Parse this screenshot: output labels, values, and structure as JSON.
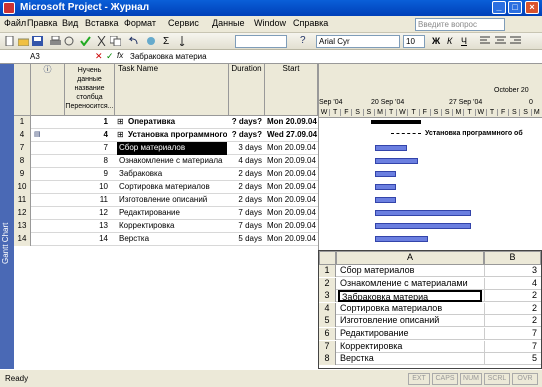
{
  "window": {
    "title": "Microsoft Project - Журнал"
  },
  "menu": [
    "Файл",
    "Правка",
    "Вид",
    "Вставка",
    "Формат",
    "Сервис",
    "Данные",
    "Window",
    "Справка"
  ],
  "help_placeholder": "Введите вопрос",
  "toolbar": {
    "font": "Arial Cyr",
    "size": "10",
    "bold": "Ж",
    "italic": "К",
    "underline": "Ч"
  },
  "formula": {
    "cell": "A3",
    "value": "Забраковка материа"
  },
  "grid": {
    "headers": {
      "ind": "ⓘ",
      "num": "Нучень данные название столбца Переносится...",
      "task": "Task Name",
      "duration": "Duration",
      "start": "Start"
    },
    "rows": [
      {
        "rn": "1",
        "num": "1",
        "name": "Оперативка",
        "dur": "? days?",
        "start": "Mon 20.09.04",
        "bold": true,
        "expand": true
      },
      {
        "rn": "4",
        "num": "4",
        "name": "Установка программного",
        "dur": "? days?",
        "start": "Wed 27.09.04",
        "bold": true,
        "expand": true
      },
      {
        "rn": "7",
        "num": "7",
        "name": "Сбор материалов",
        "dur": "3 days",
        "start": "Mon 20.09.04",
        "selected": true
      },
      {
        "rn": "8",
        "num": "8",
        "name": "Ознакомление с материала",
        "dur": "4 days",
        "start": "Mon 20.09.04"
      },
      {
        "rn": "9",
        "num": "9",
        "name": "Забраковка",
        "dur": "2 days",
        "start": "Mon 20.09.04"
      },
      {
        "rn": "10",
        "num": "10",
        "name": "Сортировка материалов",
        "dur": "2 days",
        "start": "Mon 20.09.04"
      },
      {
        "rn": "11",
        "num": "11",
        "name": "Изготовление описаний",
        "dur": "2 days",
        "start": "Mon 20.09.04"
      },
      {
        "rn": "12",
        "num": "12",
        "name": "Редактирование",
        "dur": "7 days",
        "start": "Mon 20.09.04"
      },
      {
        "rn": "13",
        "num": "13",
        "name": "Корректировка",
        "dur": "7 days",
        "start": "Mon 20.09.04"
      },
      {
        "rn": "14",
        "num": "14",
        "name": "Верстка",
        "dur": "5 days",
        "start": "Mon 20.09.04"
      }
    ]
  },
  "gantt_label": "Gantt Chart",
  "timeline": {
    "month": "October 20",
    "weeks": [
      "Sep '04",
      "20 Sep '04",
      "27 Sep '04",
      "0"
    ],
    "days": [
      "W",
      "T",
      "F",
      "S",
      "S",
      "M",
      "T",
      "W",
      "T",
      "F",
      "S",
      "S",
      "M",
      "T",
      "W",
      "T",
      "F",
      "S",
      "S",
      "M"
    ],
    "summary_label": "Установка программного об"
  },
  "excel": {
    "cols": [
      "A",
      "B"
    ],
    "rows": [
      {
        "n": "1",
        "a": "Сбор материалов",
        "b": "3"
      },
      {
        "n": "2",
        "a": "Ознакомление с материалами",
        "b": "4"
      },
      {
        "n": "3",
        "a": "Забраковка материа",
        "b": "2"
      },
      {
        "n": "4",
        "a": "Сортировка материалов",
        "b": "2"
      },
      {
        "n": "5",
        "a": "Изготовление описаний",
        "b": "2"
      },
      {
        "n": "6",
        "a": "Редактирование",
        "b": "7"
      },
      {
        "n": "7",
        "a": "Корректировка",
        "b": "7"
      },
      {
        "n": "8",
        "a": "Верстка",
        "b": "5"
      }
    ]
  },
  "status": {
    "text": "Ready",
    "ext": "EXT",
    "caps": "CAPS",
    "num": "NUM",
    "scrl": "SCRL",
    "ovr": "OVR"
  }
}
